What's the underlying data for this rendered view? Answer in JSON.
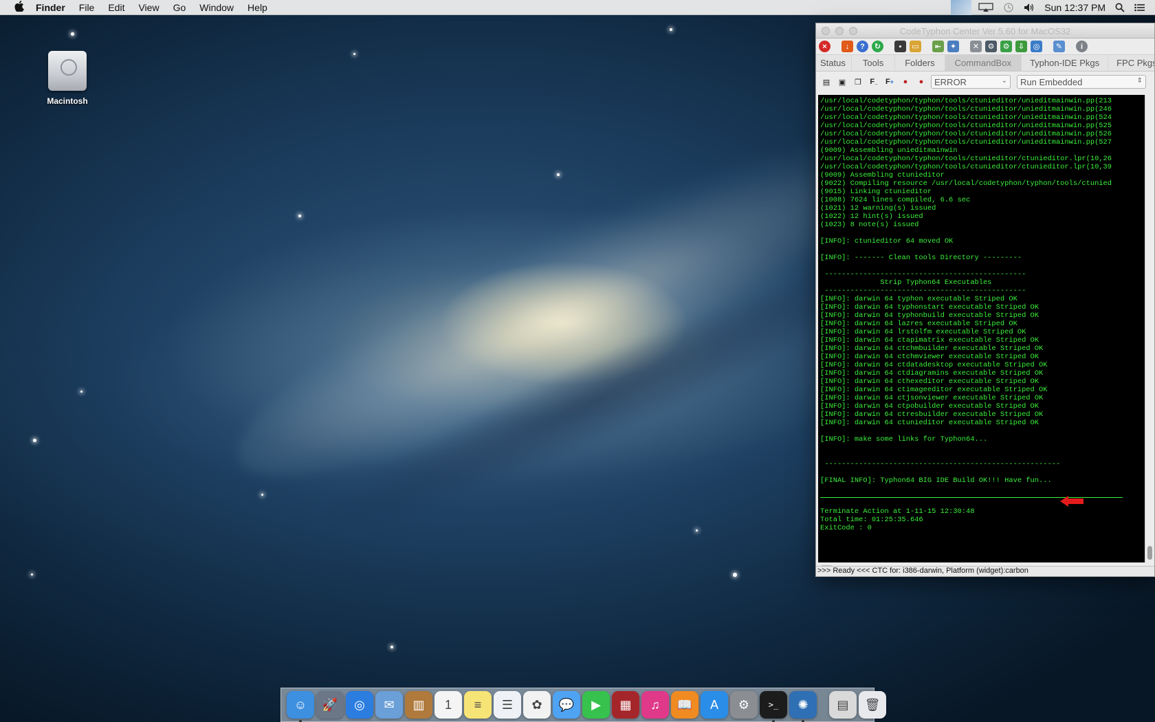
{
  "menubar": {
    "app_name": "Finder",
    "menus": [
      "File",
      "Edit",
      "View",
      "Go",
      "Window",
      "Help"
    ],
    "clock": "Sun 12:37 PM",
    "status_icons": [
      "display-thumbnail-icon",
      "airplay-icon",
      "time-machine-icon",
      "volume-icon",
      "spotlight-icon",
      "notification-center-icon"
    ]
  },
  "desktop": {
    "icons": [
      {
        "label": "Macintosh",
        "icon": "hard-drive-icon"
      }
    ]
  },
  "window": {
    "title": "CodeTyphon Center Ver 5.60 for MacOS32",
    "toolbar_icons": [
      "stop-icon",
      "download-icon",
      "help-icon",
      "refresh-icon",
      "terminal-icon",
      "folder-icon",
      "import-icon",
      "settings-icon",
      "tools-icon",
      "components-icon",
      "gear-icon",
      "build-icon",
      "grid-icon",
      "edit-icon",
      "info-icon"
    ],
    "tabs": [
      "Status",
      "Tools",
      "Folders",
      "CommandBox",
      "Typhon-IDE Pkgs",
      "FPC Pkgs"
    ],
    "active_tab": "CommandBox",
    "command_toolbar_icons": [
      "save-log-icon",
      "copy-log-icon",
      "copy-icon",
      "font-smaller-icon",
      "font-larger-icon",
      "filter-down-icon",
      "filter-up-icon"
    ],
    "filter_select": "ERROR",
    "mode_select": "Run Embedded",
    "status_text": ">>> Ready <<<  CTC for: i386-darwin, Platform (widget):carbon",
    "colors": {
      "console_bg": "#000000",
      "console_fg": "#3cf03c",
      "arrow": "#e31b1b"
    }
  },
  "console": {
    "lines": [
      "/usr/local/codetyphon/typhon/tools/ctunieditor/unieditmainwin.pp(213",
      "/usr/local/codetyphon/typhon/tools/ctunieditor/unieditmainwin.pp(246",
      "/usr/local/codetyphon/typhon/tools/ctunieditor/unieditmainwin.pp(524",
      "/usr/local/codetyphon/typhon/tools/ctunieditor/unieditmainwin.pp(525",
      "/usr/local/codetyphon/typhon/tools/ctunieditor/unieditmainwin.pp(526",
      "/usr/local/codetyphon/typhon/tools/ctunieditor/unieditmainwin.pp(527",
      "(9009) Assembling unieditmainwin",
      "/usr/local/codetyphon/typhon/tools/ctunieditor/ctunieditor.lpr(10,26",
      "/usr/local/codetyphon/typhon/tools/ctunieditor/ctunieditor.lpr(10,39",
      "(9009) Assembling ctunieditor",
      "(9022) Compiling resource /usr/local/codetyphon/typhon/tools/ctunied",
      "(9015) Linking ctunieditor",
      "(1008) 7624 lines compiled, 6.6 sec",
      "(1021) 12 warning(s) issued",
      "(1022) 12 hint(s) issued",
      "(1023) 8 note(s) issued",
      "",
      "[INFO]: ctunieditor 64 moved OK",
      "",
      "[INFO]: ------- Clean tools Directory ---------",
      "",
      " -----------------------------------------------",
      "              Strip Typhon64 Executables",
      " -----------------------------------------------",
      "[INFO]: darwin 64 typhon executable Striped OK",
      "[INFO]: darwin 64 typhonstart executable Striped OK",
      "[INFO]: darwin 64 typhonbuild executable Striped OK",
      "[INFO]: darwin 64 lazres executable Striped OK",
      "[INFO]: darwin 64 lrstolfm executable Striped OK",
      "[INFO]: darwin 64 ctapimatrix executable Striped OK",
      "[INFO]: darwin 64 ctchmbuilder executable Striped OK",
      "[INFO]: darwin 64 ctchmviewer executable Striped OK",
      "[INFO]: darwin 64 ctdatadesktop executable Striped OK",
      "[INFO]: darwin 64 ctdiagramins executable Striped OK",
      "[INFO]: darwin 64 cthexeditor executable Striped OK",
      "[INFO]: darwin 64 ctimageeditor executable Striped OK",
      "[INFO]: darwin 64 ctjsonviewer executable Striped OK",
      "[INFO]: darwin 64 ctpobuilder executable Striped OK",
      "[INFO]: darwin 64 ctresbuilder executable Striped OK",
      "[INFO]: darwin 64 ctunieditor executable Striped OK",
      "",
      "[INFO]: make some links for Typhon64...",
      "",
      "",
      " -------------------------------------------------------",
      "",
      "[FINAL INFO]: Typhon64 BIG IDE Build OK!!! Have fun...",
      ""
    ],
    "footer_lines": [
      "Terminate Action at 1-11-15 12:30:48",
      "Total time: 01:25:35.646",
      "ExitCode : 0"
    ]
  },
  "dock": {
    "apps": [
      {
        "name": "finder-icon",
        "color": "#3d8fe0",
        "running": true
      },
      {
        "name": "launchpad-icon",
        "color": "#6b7686",
        "running": false
      },
      {
        "name": "safari-icon",
        "color": "#2b7de0",
        "running": false
      },
      {
        "name": "mail-icon",
        "color": "#6a9fd8",
        "running": false
      },
      {
        "name": "contacts-icon",
        "color": "#b07a3c",
        "running": false
      },
      {
        "name": "calendar-icon",
        "color": "#f4f4f4",
        "running": false
      },
      {
        "name": "notes-icon",
        "color": "#f7e477",
        "running": false
      },
      {
        "name": "reminders-icon",
        "color": "#eef2f6",
        "running": false
      },
      {
        "name": "photos-icon",
        "color": "#f2f2f2",
        "running": false
      },
      {
        "name": "messages-icon",
        "color": "#4fa3f3",
        "running": false
      },
      {
        "name": "facetime-icon",
        "color": "#37c24e",
        "running": false
      },
      {
        "name": "photo-booth-icon",
        "color": "#a5262a",
        "running": false
      },
      {
        "name": "itunes-icon",
        "color": "#e0398a",
        "running": false
      },
      {
        "name": "ibooks-icon",
        "color": "#f08b22",
        "running": false
      },
      {
        "name": "app-store-icon",
        "color": "#2a8de8",
        "running": false
      },
      {
        "name": "system-preferences-icon",
        "color": "#8a8d92",
        "running": false
      },
      {
        "name": "terminal-icon",
        "color": "#1c1c1c",
        "running": true
      },
      {
        "name": "codetyphon-icon",
        "color": "#2f6fb4",
        "running": true
      }
    ],
    "extras": [
      {
        "name": "documents-stack-icon",
        "color": "#d9d9d9"
      },
      {
        "name": "trash-icon",
        "color": "#e7e9ec"
      }
    ]
  }
}
